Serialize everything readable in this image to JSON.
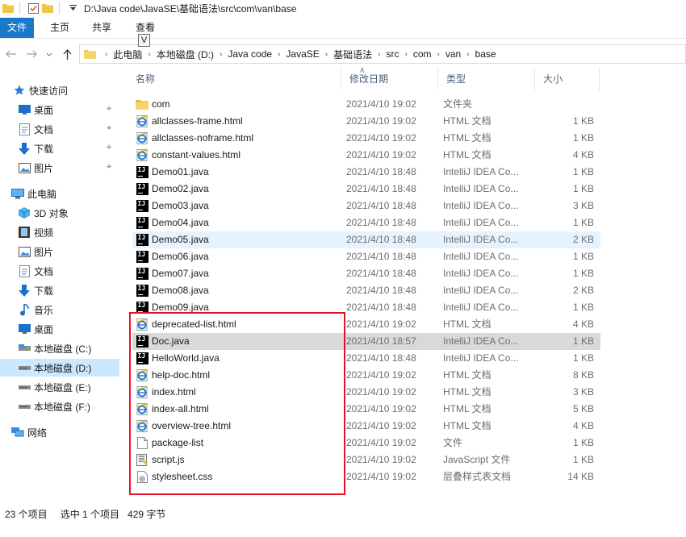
{
  "window": {
    "path": "D:\\Java code\\JavaSE\\基础语法\\src\\com\\van\\base"
  },
  "ribbon": {
    "tabs": [
      "文件",
      "主页",
      "共享",
      "查看"
    ],
    "keytip": "V"
  },
  "address": {
    "crumbs": [
      "此电脑",
      "本地磁盘 (D:)",
      "Java code",
      "JavaSE",
      "基础语法",
      "src",
      "com",
      "van",
      "base"
    ]
  },
  "nav": {
    "items": [
      {
        "label": "快速访问",
        "icon": "star-icon",
        "pinned": false
      },
      {
        "label": "桌面",
        "icon": "desktop-icon",
        "pinned": true
      },
      {
        "label": "文档",
        "icon": "documents-icon",
        "pinned": true
      },
      {
        "label": "下载",
        "icon": "download-icon",
        "pinned": true
      },
      {
        "label": "图片",
        "icon": "pictures-icon",
        "pinned": true
      },
      {
        "label": "此电脑",
        "icon": "computer-icon",
        "pinned": false
      },
      {
        "label": "3D 对象",
        "icon": "3d-objects-icon",
        "pinned": false
      },
      {
        "label": "视频",
        "icon": "video-icon",
        "pinned": false
      },
      {
        "label": "图片",
        "icon": "pictures-icon",
        "pinned": false
      },
      {
        "label": "文档",
        "icon": "documents-icon",
        "pinned": false
      },
      {
        "label": "下载",
        "icon": "download-icon",
        "pinned": false
      },
      {
        "label": "音乐",
        "icon": "music-icon",
        "pinned": false
      },
      {
        "label": "桌面",
        "icon": "desktop-icon",
        "pinned": false
      },
      {
        "label": "本地磁盘 (C:)",
        "icon": "drive-icon",
        "pinned": false
      },
      {
        "label": "本地磁盘 (D:)",
        "icon": "drive-icon",
        "pinned": false,
        "selected": true
      },
      {
        "label": "本地磁盘 (E:)",
        "icon": "drive-icon",
        "pinned": false
      },
      {
        "label": "本地磁盘 (F:)",
        "icon": "drive-icon",
        "pinned": false
      },
      {
        "label": "网络",
        "icon": "network-icon",
        "pinned": false
      }
    ]
  },
  "columns": {
    "name": "名称",
    "date": "修改日期",
    "type": "类型",
    "size": "大小"
  },
  "files": [
    {
      "name": "com",
      "date": "2021/4/10 19:02",
      "type": "文件夹",
      "size": "",
      "icon": "folder-icon"
    },
    {
      "name": "allclasses-frame.html",
      "date": "2021/4/10 19:02",
      "type": "HTML 文档",
      "size": "1 KB",
      "icon": "ie-html-icon"
    },
    {
      "name": "allclasses-noframe.html",
      "date": "2021/4/10 19:02",
      "type": "HTML 文档",
      "size": "1 KB",
      "icon": "ie-html-icon"
    },
    {
      "name": "constant-values.html",
      "date": "2021/4/10 19:02",
      "type": "HTML 文档",
      "size": "4 KB",
      "icon": "ie-html-icon"
    },
    {
      "name": "Demo01.java",
      "date": "2021/4/10 18:48",
      "type": "IntelliJ IDEA Co...",
      "size": "1 KB",
      "icon": "intellij-icon"
    },
    {
      "name": "Demo02.java",
      "date": "2021/4/10 18:48",
      "type": "IntelliJ IDEA Co...",
      "size": "1 KB",
      "icon": "intellij-icon"
    },
    {
      "name": "Demo03.java",
      "date": "2021/4/10 18:48",
      "type": "IntelliJ IDEA Co...",
      "size": "3 KB",
      "icon": "intellij-icon"
    },
    {
      "name": "Demo04.java",
      "date": "2021/4/10 18:48",
      "type": "IntelliJ IDEA Co...",
      "size": "1 KB",
      "icon": "intellij-icon"
    },
    {
      "name": "Demo05.java",
      "date": "2021/4/10 18:48",
      "type": "IntelliJ IDEA Co...",
      "size": "2 KB",
      "icon": "intellij-icon",
      "state": "hover"
    },
    {
      "name": "Demo06.java",
      "date": "2021/4/10 18:48",
      "type": "IntelliJ IDEA Co...",
      "size": "1 KB",
      "icon": "intellij-icon"
    },
    {
      "name": "Demo07.java",
      "date": "2021/4/10 18:48",
      "type": "IntelliJ IDEA Co...",
      "size": "1 KB",
      "icon": "intellij-icon"
    },
    {
      "name": "Demo08.java",
      "date": "2021/4/10 18:48",
      "type": "IntelliJ IDEA Co...",
      "size": "2 KB",
      "icon": "intellij-icon"
    },
    {
      "name": "Demo09.java",
      "date": "2021/4/10 18:48",
      "type": "IntelliJ IDEA Co...",
      "size": "1 KB",
      "icon": "intellij-icon"
    },
    {
      "name": "deprecated-list.html",
      "date": "2021/4/10 19:02",
      "type": "HTML 文档",
      "size": "4 KB",
      "icon": "ie-html-icon"
    },
    {
      "name": "Doc.java",
      "date": "2021/4/10 18:57",
      "type": "IntelliJ IDEA Co...",
      "size": "1 KB",
      "icon": "intellij-icon",
      "state": "selected"
    },
    {
      "name": "HelloWorld.java",
      "date": "2021/4/10 18:48",
      "type": "IntelliJ IDEA Co...",
      "size": "1 KB",
      "icon": "intellij-icon"
    },
    {
      "name": "help-doc.html",
      "date": "2021/4/10 19:02",
      "type": "HTML 文档",
      "size": "8 KB",
      "icon": "ie-html-icon"
    },
    {
      "name": "index.html",
      "date": "2021/4/10 19:02",
      "type": "HTML 文档",
      "size": "3 KB",
      "icon": "ie-html-icon"
    },
    {
      "name": "index-all.html",
      "date": "2021/4/10 19:02",
      "type": "HTML 文档",
      "size": "5 KB",
      "icon": "ie-html-icon"
    },
    {
      "name": "overview-tree.html",
      "date": "2021/4/10 19:02",
      "type": "HTML 文档",
      "size": "4 KB",
      "icon": "ie-html-icon"
    },
    {
      "name": "package-list",
      "date": "2021/4/10 19:02",
      "type": "文件",
      "size": "1 KB",
      "icon": "blank-file-icon"
    },
    {
      "name": "script.js",
      "date": "2021/4/10 19:02",
      "type": "JavaScript 文件",
      "size": "1 KB",
      "icon": "script-icon"
    },
    {
      "name": "stylesheet.css",
      "date": "2021/4/10 19:02",
      "type": "层叠样式表文档",
      "size": "14 KB",
      "icon": "css-icon"
    }
  ],
  "status": {
    "count": "23 个项目",
    "selection": "选中 1 个项目",
    "size": "429 字节"
  },
  "colors": {
    "accent": "#1979ca",
    "highlight": "#e81123",
    "selected_row": "#d9d9d9",
    "hover_row": "#e5f3ff"
  }
}
